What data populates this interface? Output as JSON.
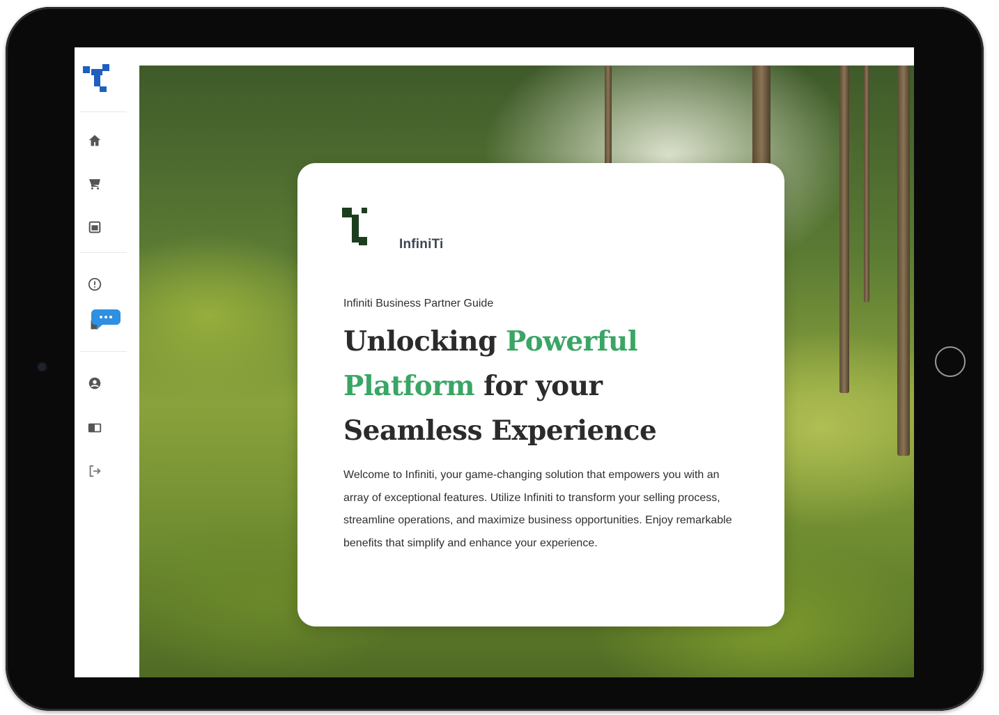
{
  "brand": {
    "name": "InfiniTi",
    "primary_color": "#1f5fbf",
    "dark_green": "#1d3d1f",
    "accent_green": "#3aa565"
  },
  "sidebar": {
    "logo_icon": "infiniti-logo-icon",
    "items": [
      {
        "icon": "home-icon",
        "label": ""
      },
      {
        "icon": "shopping-cart-icon",
        "label": ""
      },
      {
        "icon": "calendar-icon",
        "label": ""
      },
      {
        "icon": "info-icon",
        "label": ""
      },
      {
        "icon": "chat-icon",
        "label": ""
      },
      {
        "icon": "user-icon",
        "label": ""
      },
      {
        "icon": "wallet-icon",
        "label": ""
      },
      {
        "icon": "logout-icon",
        "label": ""
      }
    ]
  },
  "hero": {
    "background": "tea plantation photo"
  },
  "card": {
    "brand_name": "InfiniTi",
    "eyebrow": "Infiniti Business Partner Guide",
    "headline": {
      "part1": "Unlocking ",
      "accent": "Powerful Platform",
      "part2": " for your Seamless Experience"
    },
    "body": "Welcome to Infiniti, your game-changing solution that empowers you with an array of exceptional features. Utilize Infiniti to transform your selling process, streamline operations, and maximize business opportunities. Enjoy remarkable benefits that simplify and enhance your experience."
  }
}
